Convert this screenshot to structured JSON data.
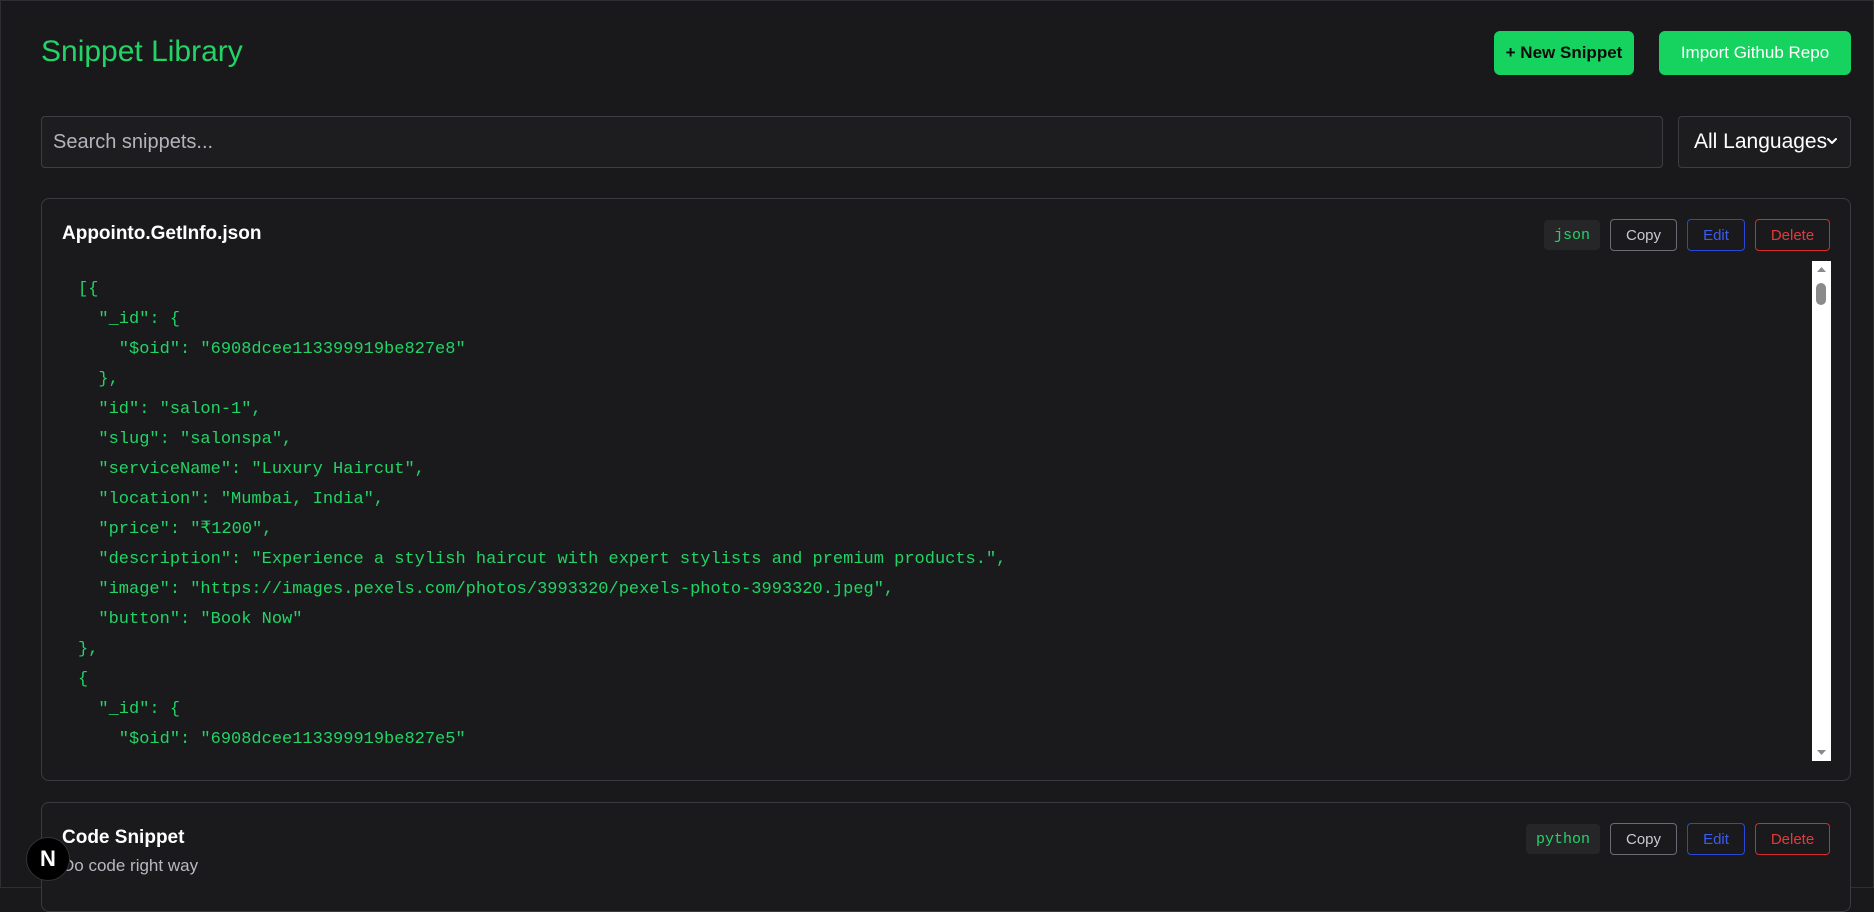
{
  "header": {
    "title": "Snippet Library",
    "new_snippet_label": "+ New Snippet",
    "import_label": "Import Github Repo"
  },
  "filters": {
    "search_placeholder": "Search snippets...",
    "language_selected": "All Languages"
  },
  "snippets": [
    {
      "title": "Appointo.GetInfo.json",
      "description": "",
      "language": "json",
      "copy_label": "Copy",
      "edit_label": "Edit",
      "delete_label": "Delete",
      "code": "[{\n  \"_id\": {\n    \"$oid\": \"6908dcee113399919be827e8\"\n  },\n  \"id\": \"salon-1\",\n  \"slug\": \"salonspa\",\n  \"serviceName\": \"Luxury Haircut\",\n  \"location\": \"Mumbai, India\",\n  \"price\": \"₹1200\",\n  \"description\": \"Experience a stylish haircut with expert stylists and premium products.\",\n  \"image\": \"https://images.pexels.com/photos/3993320/pexels-photo-3993320.jpeg\",\n  \"button\": \"Book Now\"\n},\n{\n  \"_id\": {\n    \"$oid\": \"6908dcee113399919be827e5\""
    },
    {
      "title": "Code Snippet",
      "description": "Do code right way",
      "language": "python",
      "copy_label": "Copy",
      "edit_label": "Edit",
      "delete_label": "Delete"
    }
  ],
  "floating_badge": {
    "letter": "N"
  },
  "colors": {
    "accent": "#16d35f",
    "background": "#19191b",
    "edit": "#3c5cf0",
    "delete": "#e33b3b"
  }
}
